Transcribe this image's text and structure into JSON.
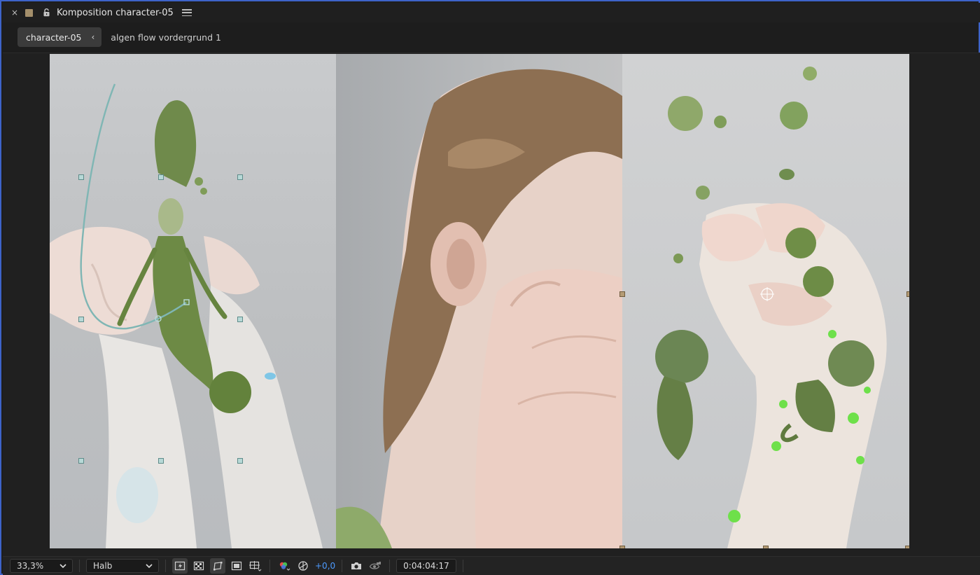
{
  "panel": {
    "close_glyph": "×",
    "label_color": "#a48f6b",
    "title": "Komposition character-05",
    "menu_icon": "hamburger-menu-icon",
    "lock_icon": "lock-icon"
  },
  "breadcrumb": {
    "current": "character-05",
    "chevron": "‹",
    "next": "algen flow vordergrund 1"
  },
  "viewer": {
    "description_panels": [
      "arms-with-creature",
      "face-with-hand",
      "hands-with-algae"
    ],
    "accent": "#3d63c9",
    "handle_color": "#b7d9d7",
    "layer_handle_color": "#b49b74"
  },
  "toolbar": {
    "zoom": "33,3%",
    "resolution": "Halb",
    "exposure": "+0,0",
    "timecode": "0:04:04:17",
    "exposure_color": "#4d9bff",
    "icons": [
      "fast-previews-icon",
      "transparency-grid-icon",
      "mask-path-visibility-icon",
      "region-of-interest-icon",
      "grid-guides-icon",
      "channels-icon",
      "reset-exposure-icon",
      "snapshot-camera-icon",
      "show-snapshot-icon"
    ]
  }
}
